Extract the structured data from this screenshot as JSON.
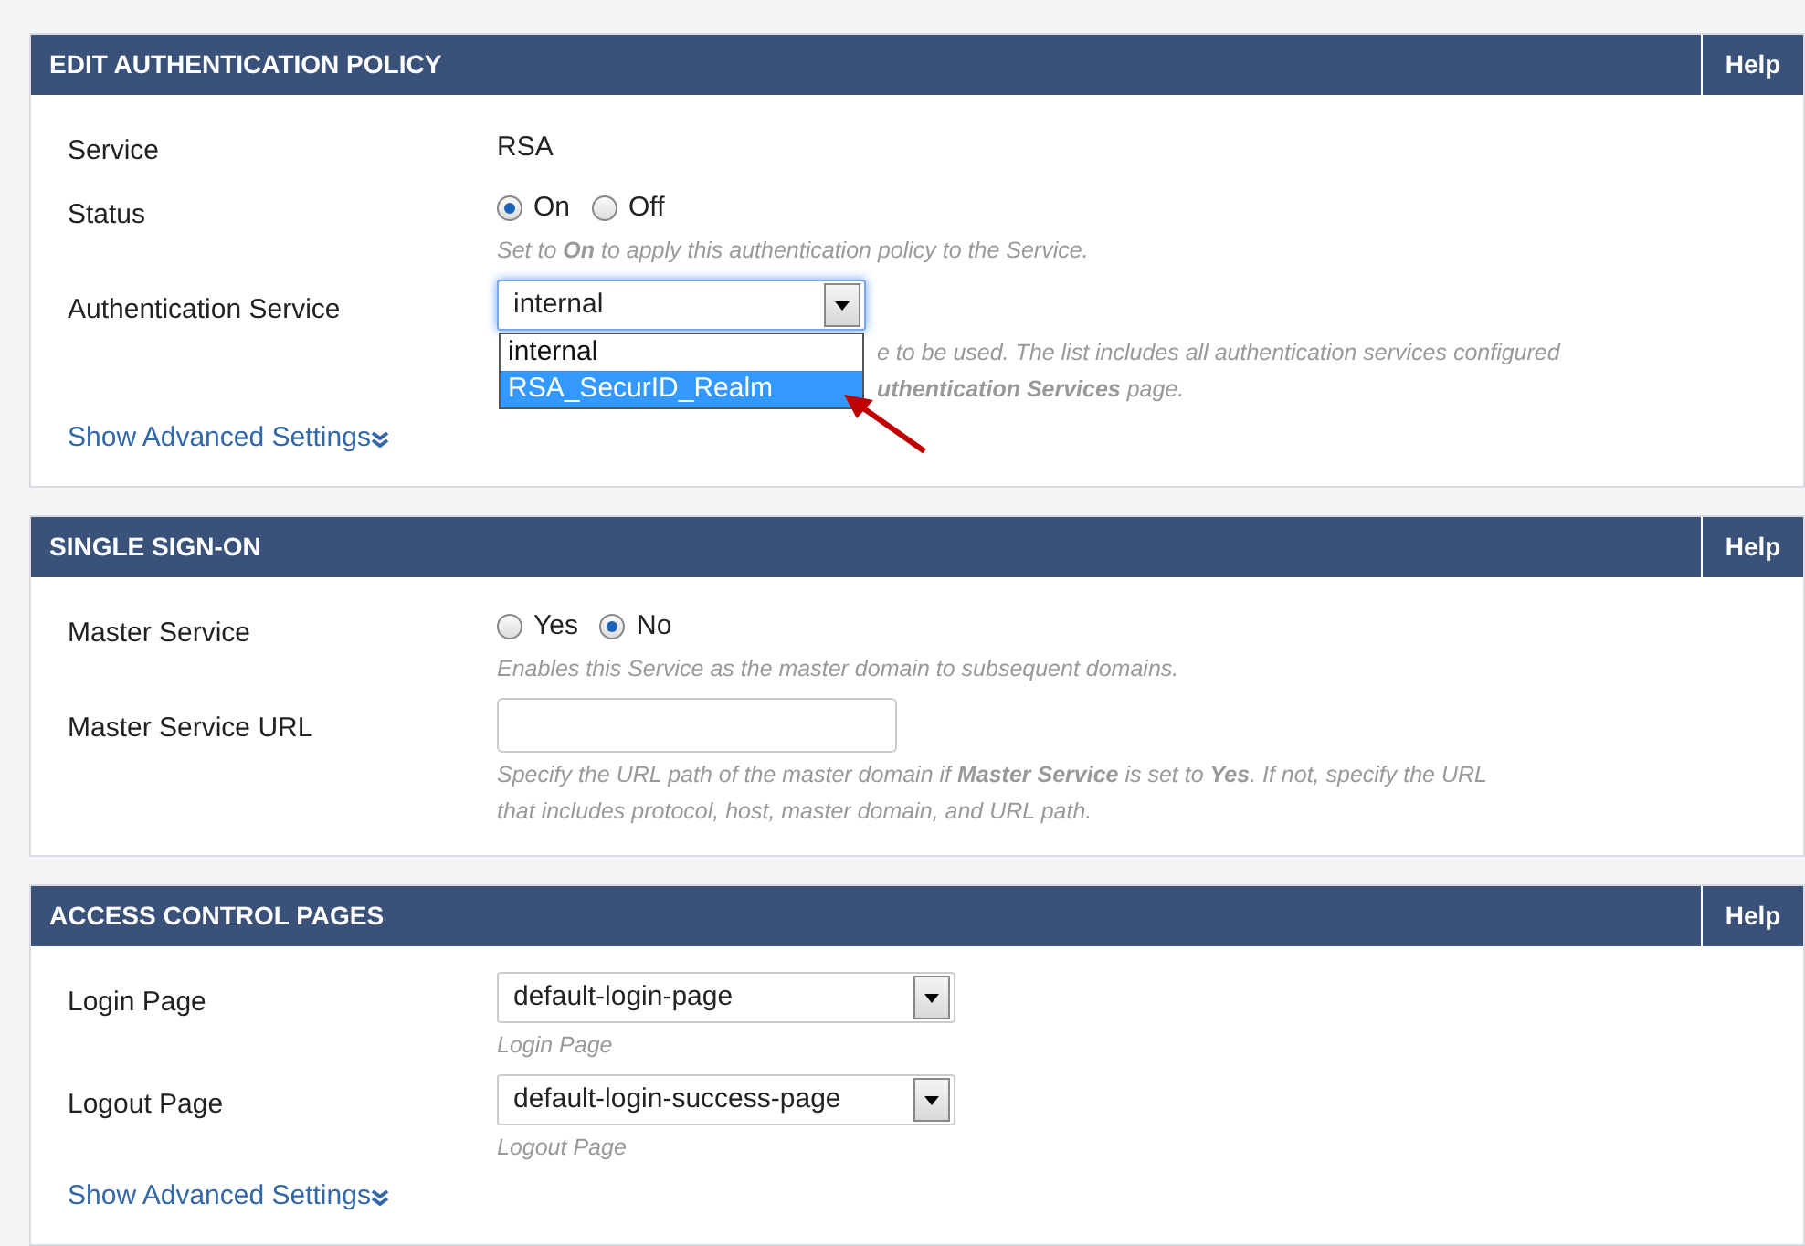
{
  "sections": [
    {
      "title": "EDIT AUTHENTICATION POLICY",
      "help": "Help",
      "rows": [
        {
          "kind": "text",
          "label": "Service",
          "value": "RSA"
        },
        {
          "kind": "radio",
          "label": "Status",
          "options": [
            {
              "label": "On",
              "selected": true
            },
            {
              "label": "Off",
              "selected": false
            }
          ],
          "hint": [
            "Set to **On** to apply this authentication policy to the Service."
          ]
        },
        {
          "kind": "select",
          "label": "Authentication Service",
          "value": "internal",
          "expanded": true,
          "options": [
            {
              "label": "internal",
              "highlighted": false
            },
            {
              "label": "RSA_SecurID_Realm",
              "highlighted": true
            }
          ],
          "hint": [
            "e to be used. The list includes all authentication services configured",
            "**uthentication Services** page."
          ]
        }
      ],
      "advanced": "Show Advanced Settings"
    },
    {
      "title": "SINGLE SIGN-ON",
      "help": "Help",
      "rows": [
        {
          "kind": "radio",
          "label": "Master Service",
          "options": [
            {
              "label": "Yes",
              "selected": false
            },
            {
              "label": "No",
              "selected": true
            }
          ],
          "hint": [
            "Enables this Service as the master domain to subsequent domains."
          ]
        },
        {
          "kind": "input",
          "label": "Master Service URL",
          "hint": [
            "Specify the URL path of the master domain if **Master Service** is set to **Yes**. If not, specify the URL",
            "that includes protocol, host, master domain, and URL path."
          ]
        }
      ]
    },
    {
      "title": "ACCESS CONTROL PAGES",
      "help": "Help",
      "rows": [
        {
          "kind": "select",
          "label": "Login Page",
          "value": "default-login-page",
          "expanded": false,
          "hint": [
            "Login Page"
          ]
        },
        {
          "kind": "select",
          "label": "Logout Page",
          "value": "default-login-success-page",
          "expanded": false,
          "hint": [
            "Logout Page"
          ]
        }
      ],
      "advanced": "Show Advanced Settings"
    }
  ]
}
